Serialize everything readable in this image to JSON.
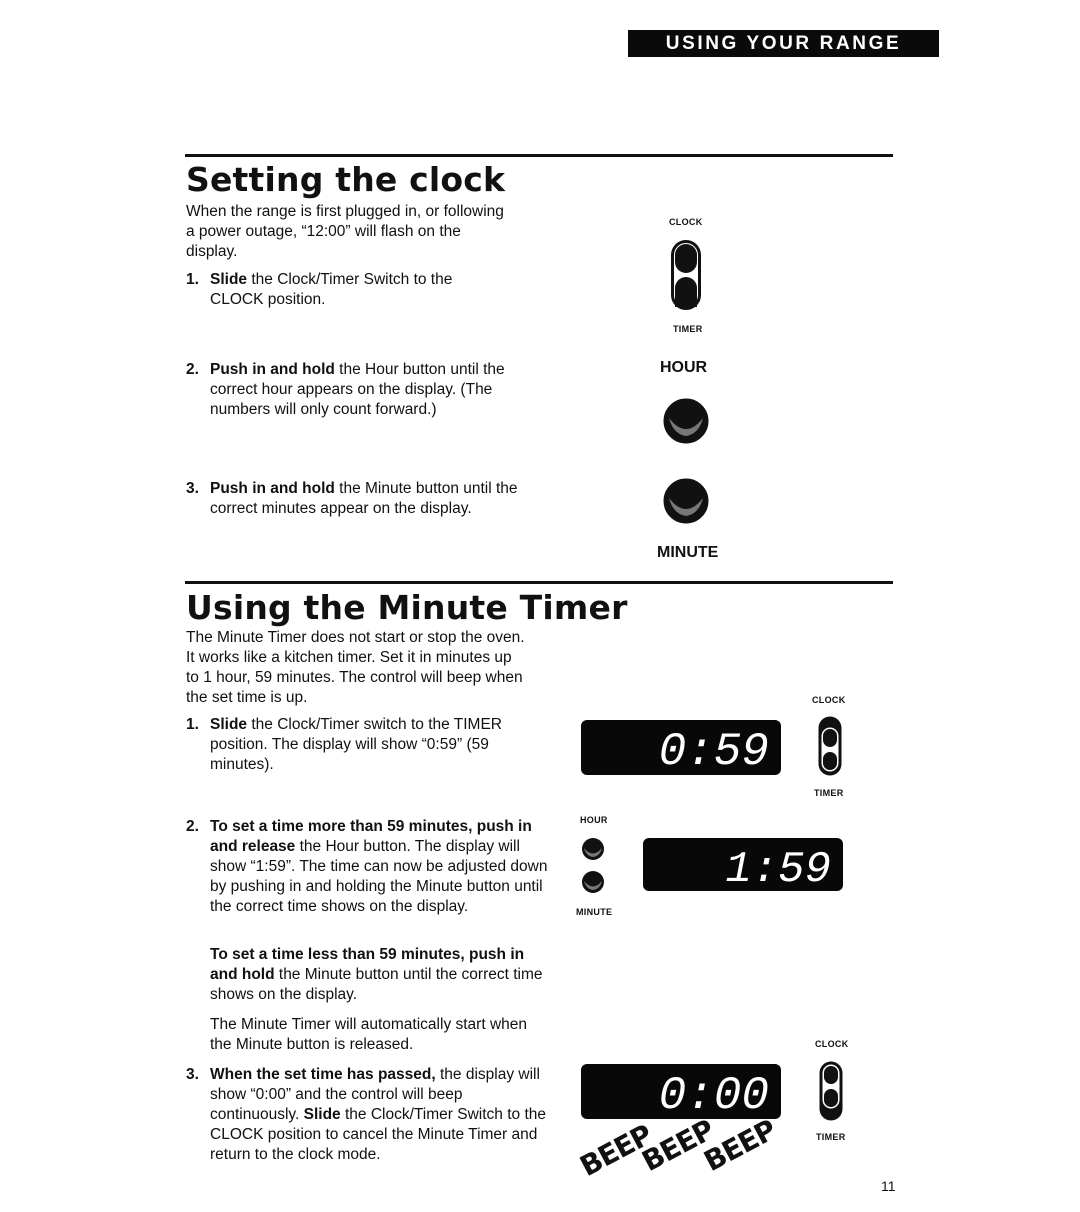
{
  "header": {
    "section_banner": "USING YOUR RANGE"
  },
  "clock_section": {
    "title": "Setting the clock",
    "intro": "When the range is first plugged in, or following a power outage, “12:00” will flash on the display.",
    "steps": [
      {
        "num": "1.",
        "bold": "Slide",
        "text": " the Clock/Timer Switch to the CLOCK position."
      },
      {
        "num": "2.",
        "bold": "Push in and hold",
        "text": " the Hour button until the correct hour appears on the display. (The numbers will only count forward.)"
      },
      {
        "num": "3.",
        "bold": "Push in and hold",
        "text": " the Minute button until the correct minutes appear on the display."
      }
    ],
    "figure": {
      "switch_top_label": "CLOCK",
      "switch_bottom_label": "TIMER",
      "hour_label": "HOUR",
      "minute_label": "MINUTE"
    }
  },
  "timer_section": {
    "title": "Using the Minute Timer",
    "intro": "The Minute Timer does not start or stop the oven. It works like a kitchen timer. Set it in minutes up to 1 hour, 59 minutes. The control will beep when the set time is up.",
    "steps": [
      {
        "num": "1.",
        "bold": "Slide",
        "text": " the Clock/Timer switch to the TIMER position. The display will show “0:59” (59 minutes)."
      },
      {
        "num": "2.",
        "bold": "To set a time more than 59 minutes, push in and release",
        "text": " the Hour button. The display will show “1:59”. The time can now be adjusted down by pushing in and holding the Minute button until the correct time shows on the display."
      },
      {
        "num": "3.",
        "bold": "When the set time has passed,",
        "text": " the display will show “0:00” and the control will beep continuously. ",
        "bold2": "Slide",
        "text2": " the Clock/Timer Switch to the CLOCK position to cancel the Minute Timer and return to the clock mode."
      }
    ],
    "step2_extra": {
      "bold": "To set a time less than 59 minutes, push in and hold",
      "text": " the Minute button until the correct time shows on the display."
    },
    "step2_note": "The Minute Timer will automatically start when the Minute button is released.",
    "figures": {
      "display1": "0:59",
      "display2": "1:59",
      "display3": "0:00",
      "switch_top_label": "CLOCK",
      "switch_bottom_label": "TIMER",
      "hour_label": "HOUR",
      "minute_label": "MINUTE",
      "beep_words": [
        "BEEP",
        "BEEP",
        "BEEP"
      ]
    }
  },
  "footer": {
    "page_number": "11"
  }
}
